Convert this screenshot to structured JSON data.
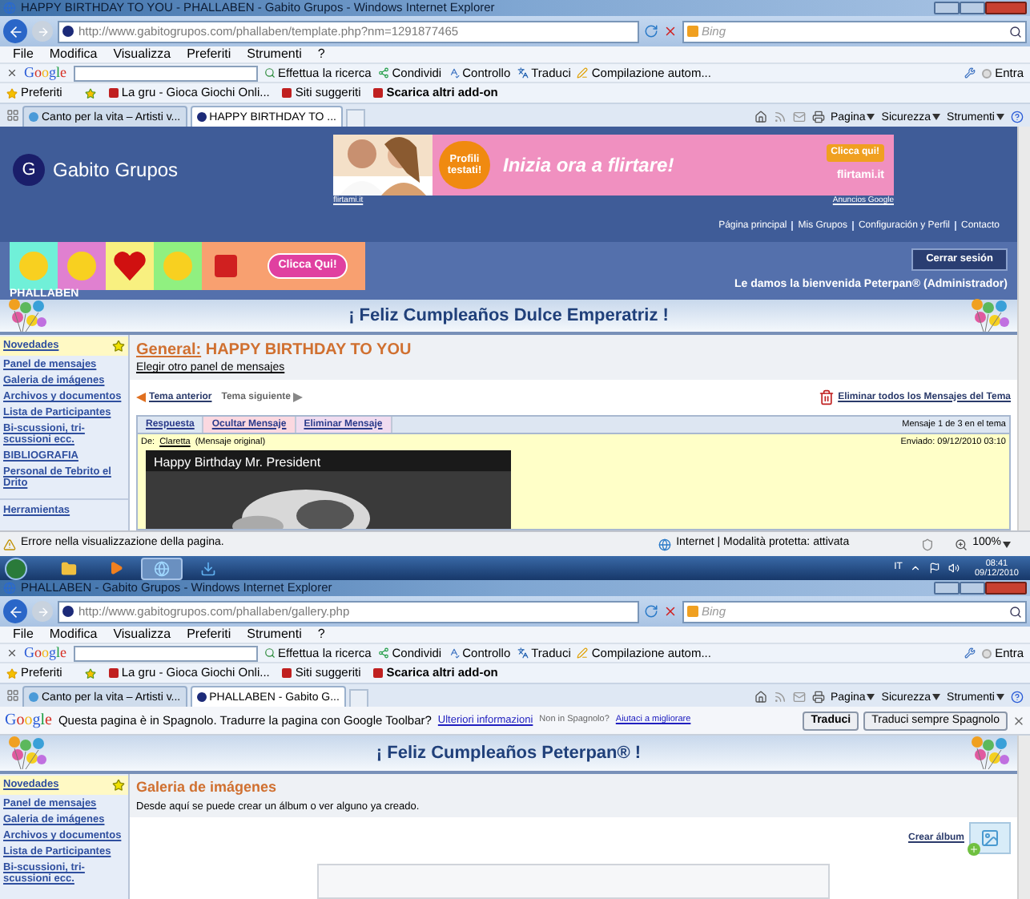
{
  "windows": [
    {
      "title": "HAPPY BIRTHDAY TO YOU - PHALLABEN - Gabito Grupos - Windows Internet Explorer",
      "url": "http://www.gabitogrupos.com/phallaben/template.php?nm=1291877465",
      "search_placeholder": "Bing",
      "menu": [
        "File",
        "Modifica",
        "Visualizza",
        "Preferiti",
        "Strumenti",
        "?"
      ],
      "google_toolbar": {
        "logo": "Google",
        "items": [
          "Effettua la ricerca",
          "Condividi",
          "Controllo",
          "Traduci",
          "Compilazione autom..."
        ],
        "signin": "Entra"
      },
      "favorites": {
        "label": "Preferiti",
        "links": [
          "La gru - Gioca Giochi Onli...",
          "Siti suggeriti",
          "Scarica altri add-on"
        ]
      },
      "tabs": [
        {
          "label": "Canto per la vita – Artisti v...",
          "selected": false
        },
        {
          "label": "HAPPY BIRTHDAY TO ...",
          "selected": true
        }
      ],
      "command_bar": [
        "Pagina",
        "Sicurezza",
        "Strumenti"
      ],
      "page": {
        "kind": "topic",
        "site_name": "Gabito Grupos",
        "logo_letter": "G",
        "ad": {
          "badge": "Profili testati!",
          "headline": "Inizia ora a flirtare!",
          "button": "Clicca qui!",
          "brand": "flirtami.it",
          "link_left": "flirtami.it",
          "link_right": "Anuncios Google"
        },
        "top_links": [
          "Página principal",
          "Mis Grupos",
          "Configuración y Perfil",
          "Contacto"
        ],
        "group_banner_button": "Clicca Qui!",
        "group_name": "PHALLABEN",
        "logout": "Cerrar sesión",
        "welcome": "Le damos la bienvenida Peterpan® (Administrador)",
        "greeting": "¡ Feliz Cumpleaños Dulce Emperatriz !",
        "sidebar": [
          {
            "label": "Novedades",
            "selected": true
          },
          {
            "label": "Panel de mensajes",
            "selected": false
          },
          {
            "label": "Galeria de imágenes",
            "selected": false
          },
          {
            "label": "Archivos y documentos",
            "selected": false
          },
          {
            "label": "Lista de Participantes",
            "selected": false
          },
          {
            "label": "Bi-scussioni, tri-scussioni ecc.",
            "selected": false
          },
          {
            "label": "BIBLIOGRAFIA",
            "selected": false
          },
          {
            "label": "Personal de Tebrito el Drito",
            "selected": false
          }
        ],
        "tools": "Herramientas",
        "topic": {
          "board": "General:",
          "title": "HAPPY BIRTHDAY TO YOU",
          "change_board": "Elegir otro panel de mensajes",
          "prev": "Tema anterior",
          "next": "Tema siguiente",
          "delete_all": "Eliminar todos los Mensajes del Tema",
          "actions": [
            "Respuesta",
            "Ocultar Mensaje",
            "Eliminar Mensaje"
          ],
          "count": "Mensaje 1 de 3 en el tema",
          "from": "De:",
          "author": "Claretta",
          "note": "(Mensaje original)",
          "sent": "Enviado: 09/12/2010 03:10",
          "video_title": "Happy Birthday Mr. President"
        }
      },
      "status_bar": {
        "message": "Errore nella visualizzazione della pagina.",
        "zone": "Internet | Modalità protetta: attivata",
        "zoom": "100%"
      }
    },
    {
      "title": "PHALLABEN - Gabito Grupos - Windows Internet Explorer",
      "url": "http://www.gabitogrupos.com/phallaben/gallery.php",
      "search_placeholder": "Bing",
      "menu": [
        "File",
        "Modifica",
        "Visualizza",
        "Preferiti",
        "Strumenti",
        "?"
      ],
      "google_toolbar": {
        "logo": "Google",
        "items": [
          "Effettua la ricerca",
          "Condividi",
          "Controllo",
          "Traduci",
          "Compilazione autom..."
        ],
        "signin": "Entra"
      },
      "favorites": {
        "label": "Preferiti",
        "links": [
          "La gru - Gioca Giochi Onli...",
          "Siti suggeriti",
          "Scarica altri add-on"
        ]
      },
      "tabs": [
        {
          "label": "Canto per la vita – Artisti v...",
          "selected": false
        },
        {
          "label": "PHALLABEN - Gabito G...",
          "selected": true
        }
      ],
      "command_bar": [
        "Pagina",
        "Sicurezza",
        "Strumenti"
      ],
      "translate_bar": {
        "logo": "Google",
        "question": "Questa pagina è in Spagnolo. Tradurre la pagina con Google Toolbar?",
        "more_info": "Ulteriori informazioni",
        "not_language": "Non in Spagnolo?",
        "help": "Aiutaci a migliorare",
        "buttons": [
          "Traduci",
          "Traduci sempre Spagnolo"
        ]
      },
      "page": {
        "kind": "gallery",
        "greeting": "¡ Feliz Cumpleaños Peterpan® !",
        "sidebar": [
          {
            "label": "Novedades",
            "selected": true
          },
          {
            "label": "Panel de mensajes",
            "selected": false
          },
          {
            "label": "Galeria de imágenes",
            "selected": false
          },
          {
            "label": "Archivos y documentos",
            "selected": false
          },
          {
            "label": "Lista de Participantes",
            "selected": false
          },
          {
            "label": "Bi-scussioni, tri-scussioni ecc.",
            "selected": false
          }
        ],
        "gallery": {
          "title": "Galeria de imágenes",
          "description": "Desde aquí se puede crear un álbum o ver alguno ya creado.",
          "create": "Crear álbum"
        }
      }
    }
  ],
  "taskbar": {
    "language": "IT",
    "time": "08:41",
    "date": "09/12/2010"
  }
}
